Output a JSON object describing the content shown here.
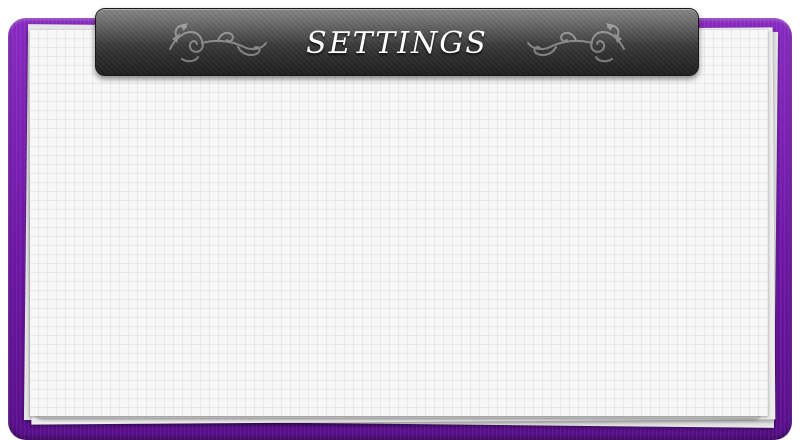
{
  "settings_panel": {
    "title": "SETTINGS"
  },
  "colors": {
    "frame": "#7a1cb6",
    "header": "#3a3a3a",
    "paper": "#f7f7f7",
    "title_text": "#ffffff"
  },
  "icons": {
    "ornament_left": "swirl-ornament-icon",
    "ornament_right": "swirl-ornament-icon"
  }
}
